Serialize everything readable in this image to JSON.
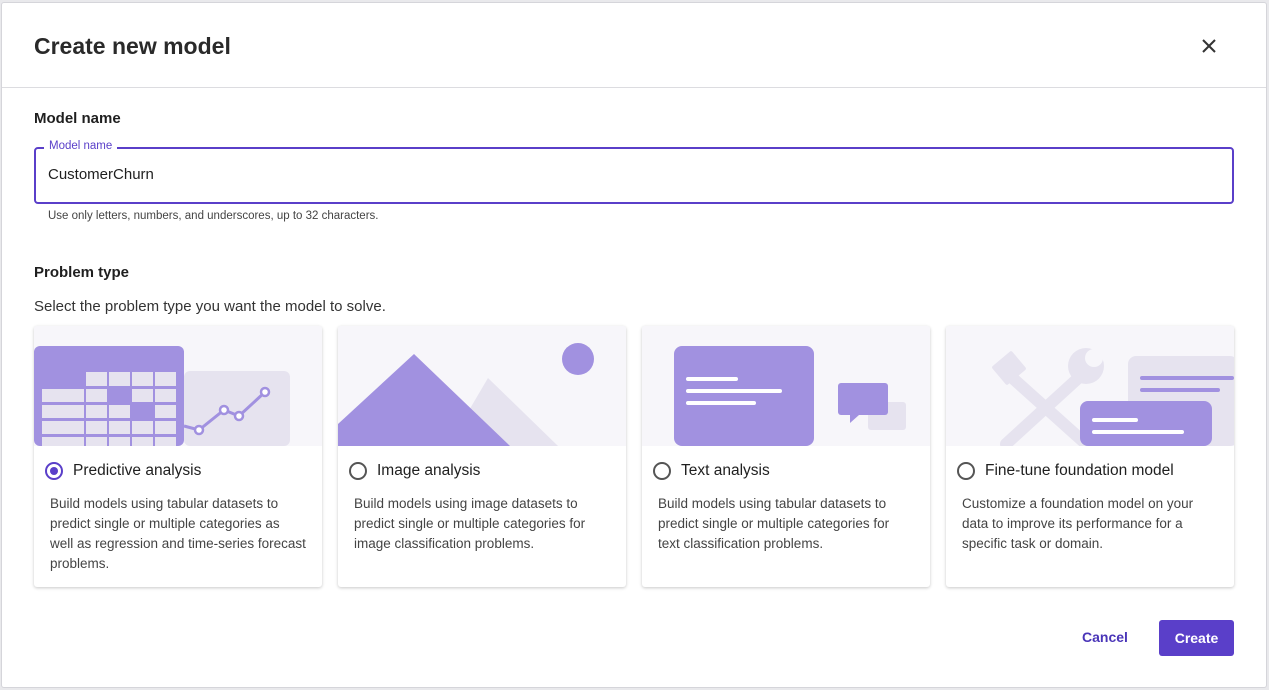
{
  "dialog": {
    "title": "Create new model"
  },
  "model_name": {
    "section_label": "Model name",
    "field_label": "Model name",
    "value": "CustomerChurn",
    "helper": "Use only letters, numbers, and underscores, up to 32 characters."
  },
  "problem_type": {
    "section_label": "Problem type",
    "subtext": "Select the problem type you want the model to solve.",
    "options": [
      {
        "title": "Predictive analysis",
        "description": "Build models using tabular datasets to predict single or multiple categories as well as regression and time-series forecast problems.",
        "selected": true,
        "icon": "table-chart-illustration"
      },
      {
        "title": "Image analysis",
        "description": "Build models using image datasets to predict single or multiple categories for image classification problems.",
        "selected": false,
        "icon": "image-mountains-illustration"
      },
      {
        "title": "Text analysis",
        "description": "Build models using tabular datasets to predict single or multiple categories for text classification problems.",
        "selected": false,
        "icon": "text-document-illustration"
      },
      {
        "title": "Fine-tune foundation model",
        "description": "Customize a foundation model on your data to improve its performance for a specific task or domain.",
        "selected": false,
        "icon": "tools-illustration"
      }
    ]
  },
  "footer": {
    "cancel_label": "Cancel",
    "create_label": "Create"
  },
  "colors": {
    "accent": "#5a3fc9",
    "illustration_primary": "#a191e0",
    "illustration_secondary": "#e6e3ef"
  }
}
